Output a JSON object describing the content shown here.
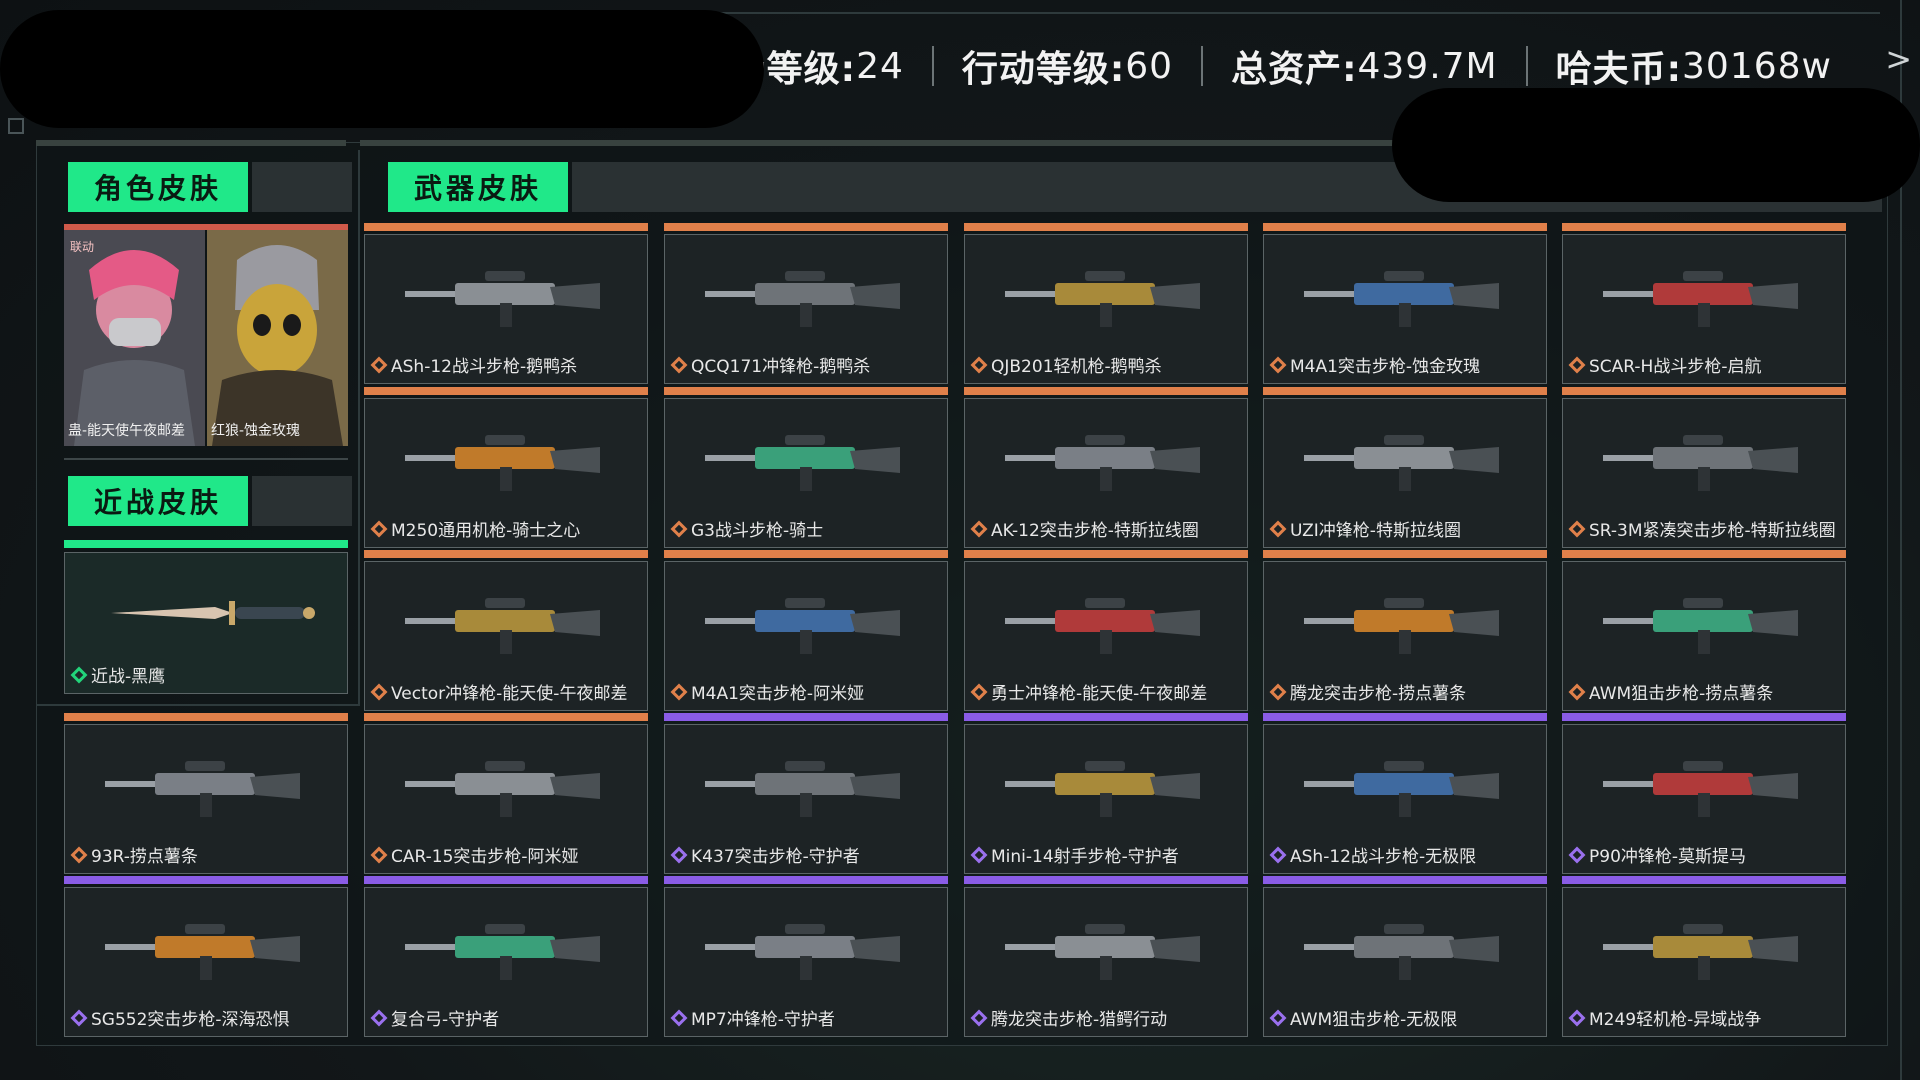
{
  "header": {
    "stats": [
      {
        "label": "战场等级:",
        "value": "24"
      },
      {
        "label": "行动等级:",
        "value": "60"
      },
      {
        "label": "总资产:",
        "value": "439.7M"
      },
      {
        "label": "哈夫币:",
        "value": "30168w"
      }
    ],
    "arrow": ">"
  },
  "sections": {
    "character": "角色皮肤",
    "weapon": "武器皮肤",
    "melee": "近战皮肤"
  },
  "characters": [
    {
      "tag": "联动",
      "name": "蛊-能天使午夜邮差"
    },
    {
      "tag": "",
      "name": "红狼-蚀金玫瑰"
    }
  ],
  "melee": {
    "name": "近战-黑鹰"
  },
  "weapons": [
    {
      "name": "ASh-12战斗步枪-鹅鸭杀",
      "rarity": "orange"
    },
    {
      "name": "QCQ171冲锋枪-鹅鸭杀",
      "rarity": "orange"
    },
    {
      "name": "QJB201轻机枪-鹅鸭杀",
      "rarity": "orange"
    },
    {
      "name": "M4A1突击步枪-蚀金玫瑰",
      "rarity": "orange"
    },
    {
      "name": "SCAR-H战斗步枪-启航",
      "rarity": "orange"
    },
    {
      "name": "M250通用机枪-骑士之心",
      "rarity": "orange"
    },
    {
      "name": "G3战斗步枪-骑士",
      "rarity": "orange"
    },
    {
      "name": "AK-12突击步枪-特斯拉线圈",
      "rarity": "orange"
    },
    {
      "name": "UZI冲锋枪-特斯拉线圈",
      "rarity": "orange"
    },
    {
      "name": "SR-3M紧凑突击步枪-特斯拉线圈",
      "rarity": "orange"
    },
    {
      "name": "Vector冲锋枪-能天使-午夜邮差",
      "rarity": "orange"
    },
    {
      "name": "M4A1突击步枪-阿米娅",
      "rarity": "orange"
    },
    {
      "name": "勇士冲锋枪-能天使-午夜邮差",
      "rarity": "orange"
    },
    {
      "name": "腾龙突击步枪-捞点薯条",
      "rarity": "orange"
    },
    {
      "name": "AWM狙击步枪-捞点薯条",
      "rarity": "orange"
    },
    {
      "name": "93R-捞点薯条",
      "rarity": "orange"
    },
    {
      "name": "CAR-15突击步枪-阿米娅",
      "rarity": "orange"
    },
    {
      "name": "K437突击步枪-守护者",
      "rarity": "purple"
    },
    {
      "name": "Mini-14射手步枪-守护者",
      "rarity": "purple"
    },
    {
      "name": "ASh-12战斗步枪-无极限",
      "rarity": "purple"
    },
    {
      "name": "P90冲锋枪-莫斯提马",
      "rarity": "purple"
    },
    {
      "name": "SG552突击步枪-深海恐惧",
      "rarity": "purple"
    },
    {
      "name": "复合弓-守护者",
      "rarity": "purple"
    },
    {
      "name": "MP7冲锋枪-守护者",
      "rarity": "purple"
    },
    {
      "name": "腾龙突击步枪-猎鳄行动",
      "rarity": "purple"
    },
    {
      "name": "AWM狙击步枪-无极限",
      "rarity": "purple"
    },
    {
      "name": "M249轻机枪-异域战争",
      "rarity": "purple"
    }
  ],
  "colors": {
    "accent_green": "#20e889",
    "rarity_orange": "#e0804a",
    "rarity_purple": "#8a5ce6"
  }
}
